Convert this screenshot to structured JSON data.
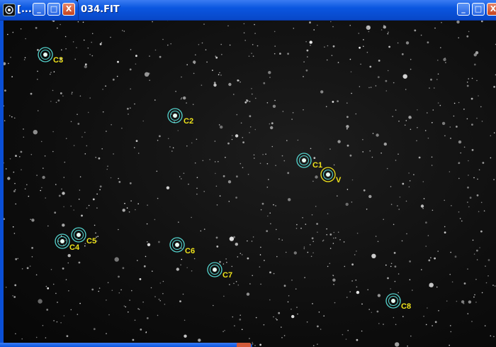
{
  "background_window": {
    "title": "034.FIT",
    "buttons": {
      "minimize": "_",
      "maximize": "□",
      "close": "X"
    }
  },
  "foreground_window": {
    "title": "[...",
    "icon": "app-icon",
    "buttons": {
      "minimize": "_",
      "maximize": "□",
      "close": "X"
    }
  },
  "colors": {
    "comparison_ring": "#55d6d0",
    "variable_ring": "#f0e41b",
    "label": "#f0e41b"
  },
  "stars": {
    "comparison": [
      {
        "id": "C1",
        "label": "C1"
      },
      {
        "id": "C2",
        "label": "C2"
      },
      {
        "id": "C3",
        "label": "C3"
      },
      {
        "id": "C4",
        "label": "C4"
      },
      {
        "id": "C5",
        "label": "C5"
      },
      {
        "id": "C6",
        "label": "C6"
      },
      {
        "id": "C7",
        "label": "C7"
      },
      {
        "id": "C8",
        "label": "C8"
      }
    ],
    "variable": {
      "id": "V",
      "label": "V"
    }
  }
}
